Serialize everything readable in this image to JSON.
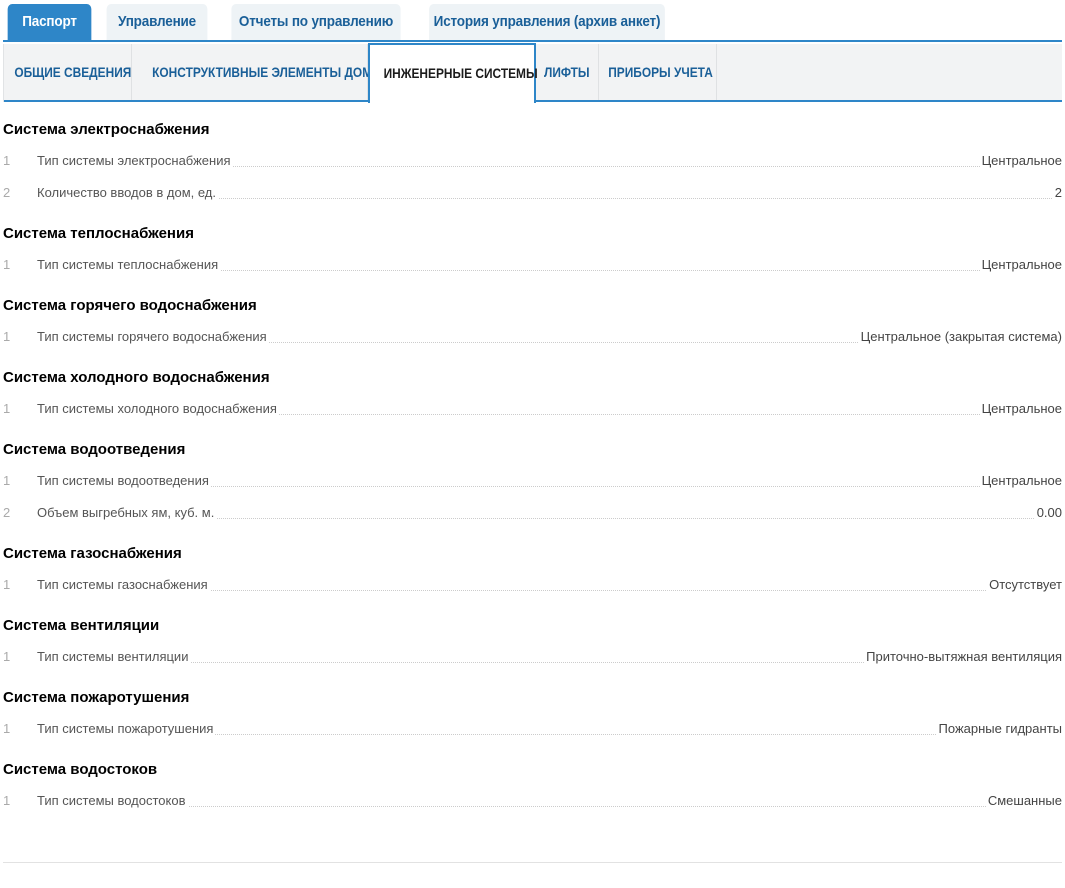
{
  "top_tabs": [
    {
      "label": "Паспорт",
      "active": true
    },
    {
      "label": "Управление"
    },
    {
      "label": "Отчеты по управлению"
    },
    {
      "label": "История управления (архив анкет)"
    }
  ],
  "sub_tabs": [
    {
      "label": "ОБЩИЕ СВЕДЕНИЯ"
    },
    {
      "label": "КОНСТРУКТИВНЫЕ ЭЛЕМЕНТЫ ДОМА"
    },
    {
      "label": "ИНЖЕНЕРНЫЕ СИСТЕМЫ",
      "active": true
    },
    {
      "label": "ЛИФТЫ"
    },
    {
      "label": "ПРИБОРЫ УЧЕТА"
    }
  ],
  "sections": [
    {
      "title": "Система электроснабжения",
      "rows": [
        {
          "num": "1",
          "label": "Тип системы электроснабжения",
          "value": "Центральное"
        },
        {
          "num": "2",
          "label": "Количество вводов в дом, ед.",
          "value": "2"
        }
      ]
    },
    {
      "title": "Система теплоснабжения",
      "rows": [
        {
          "num": "1",
          "label": "Тип системы теплоснабжения",
          "value": "Центральное"
        }
      ]
    },
    {
      "title": "Система горячего водоснабжения",
      "rows": [
        {
          "num": "1",
          "label": "Тип системы горячего водоснабжения",
          "value": "Центральное (закрытая система)"
        }
      ]
    },
    {
      "title": "Система холодного водоснабжения",
      "rows": [
        {
          "num": "1",
          "label": "Тип системы холодного водоснабжения",
          "value": "Центральное"
        }
      ]
    },
    {
      "title": "Система водоотведения",
      "rows": [
        {
          "num": "1",
          "label": "Тип системы водоотведения",
          "value": "Центральное"
        },
        {
          "num": "2",
          "label": "Объем выгребных ям, куб. м.",
          "value": "0.00"
        }
      ]
    },
    {
      "title": "Система газоснабжения",
      "rows": [
        {
          "num": "1",
          "label": "Тип системы газоснабжения",
          "value": "Отсутствует"
        }
      ]
    },
    {
      "title": "Система вентиляции",
      "rows": [
        {
          "num": "1",
          "label": "Тип системы вентиляции",
          "value": "Приточно-вытяжная вентиляция"
        }
      ]
    },
    {
      "title": "Система пожаротушения",
      "rows": [
        {
          "num": "1",
          "label": "Тип системы пожаротушения",
          "value": "Пожарные гидранты"
        }
      ]
    },
    {
      "title": "Система водостоков",
      "rows": [
        {
          "num": "1",
          "label": "Тип системы водостоков",
          "value": "Смешанные"
        }
      ]
    }
  ],
  "colors": {
    "accent": "#2e86c8",
    "tab_text": "#1a5f98",
    "tab_bg": "#eef3f6"
  }
}
